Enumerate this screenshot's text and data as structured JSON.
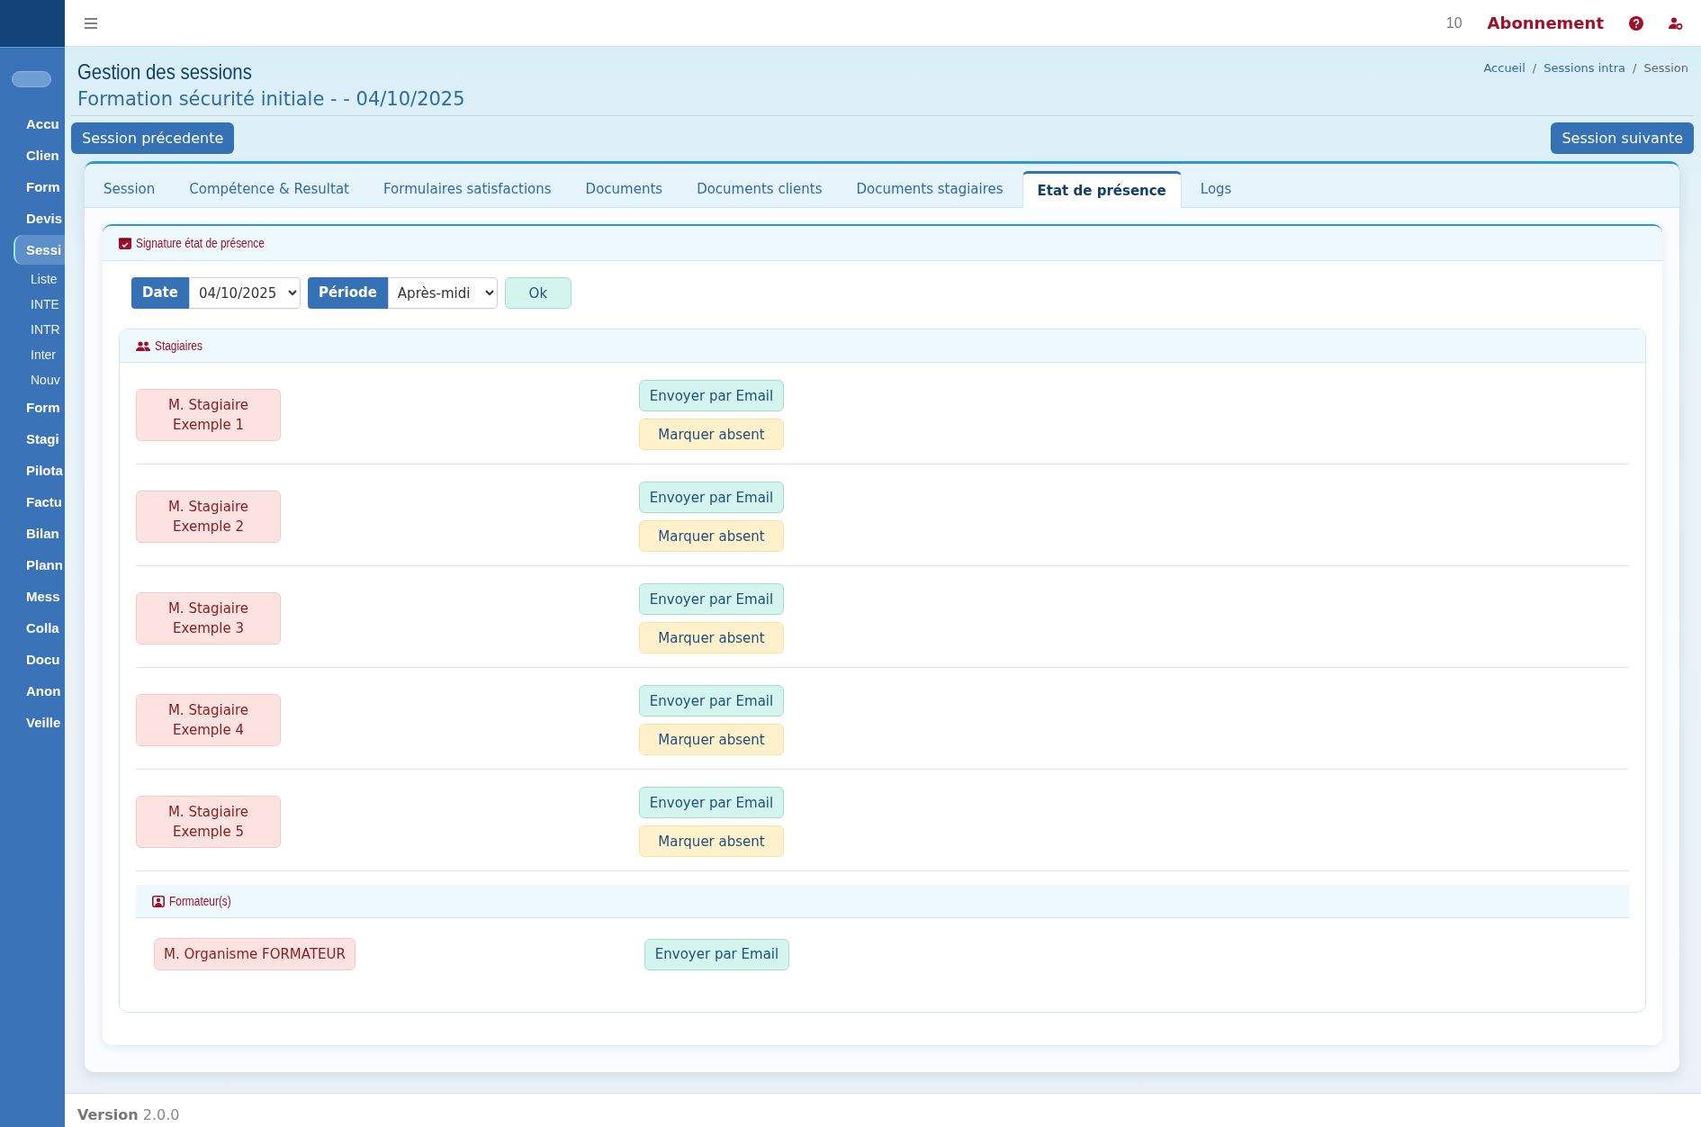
{
  "sidebar": {
    "toggle": {
      "on": false
    },
    "items": [
      {
        "label": "Accu",
        "selected": false
      },
      {
        "label": "Clien",
        "selected": false
      },
      {
        "label": "Form",
        "selected": false
      },
      {
        "label": "Devis",
        "selected": false
      },
      {
        "label": "Sessi",
        "selected": true,
        "children": [
          {
            "label": "Liste"
          },
          {
            "label": "INTE"
          },
          {
            "label": "INTR"
          },
          {
            "label": "Inter"
          },
          {
            "label": "Nouv"
          }
        ]
      },
      {
        "label": "Form",
        "selected": false
      },
      {
        "label": "Stagi",
        "selected": false
      },
      {
        "label": "Pilota",
        "selected": false
      },
      {
        "label": "Factu",
        "selected": false
      },
      {
        "label": "Bilan",
        "selected": false
      },
      {
        "label": "Plann",
        "selected": false
      },
      {
        "label": "Mess",
        "selected": false
      },
      {
        "label": "Colla",
        "selected": false
      },
      {
        "label": "Docu",
        "selected": false
      },
      {
        "label": "Anon",
        "selected": false
      },
      {
        "label": "Veille",
        "selected": false
      }
    ]
  },
  "topbar": {
    "counter": "10",
    "subscription": "Abonnement"
  },
  "page": {
    "title": "Gestion des sessions",
    "subtitle": "Formation sécurité initiale - - 04/10/2025",
    "breadcrumb": [
      {
        "label": "Accueil",
        "kind": "link"
      },
      {
        "label": "Sessions intra",
        "kind": "link"
      },
      {
        "label": "Session",
        "kind": "current"
      }
    ],
    "separator": "/"
  },
  "nav_buttons": {
    "previous": "Session précedente",
    "next": "Session suivante"
  },
  "tabs": [
    {
      "label": "Session",
      "selected": false
    },
    {
      "label": "Compétence & Resultat",
      "selected": false
    },
    {
      "label": "Formulaires satisfactions",
      "selected": false
    },
    {
      "label": "Documents",
      "selected": false
    },
    {
      "label": "Documents clients",
      "selected": false
    },
    {
      "label": "Documents stagiaires",
      "selected": false
    },
    {
      "label": "Etat de présence",
      "selected": true
    },
    {
      "label": "Logs",
      "selected": false
    }
  ],
  "attendance": {
    "title": "Signature état de présence",
    "filters": {
      "date_label": "Date",
      "date_value": "04/10/2025",
      "period_label": "Période",
      "period_value": "Après-midi",
      "submit": "Ok"
    },
    "trainees": {
      "title": "Stagiaires",
      "rows": [
        {
          "name": "M. Stagiaire Exemple 1",
          "actions": [
            {
              "label": "Envoyer par Email",
              "kind": "email"
            },
            {
              "label": "Marquer absent",
              "kind": "absent"
            }
          ]
        },
        {
          "name": "M. Stagiaire Exemple 2",
          "actions": [
            {
              "label": "Envoyer par Email",
              "kind": "email"
            },
            {
              "label": "Marquer absent",
              "kind": "absent"
            }
          ]
        },
        {
          "name": "M. Stagiaire Exemple 3",
          "actions": [
            {
              "label": "Envoyer par Email",
              "kind": "email"
            },
            {
              "label": "Marquer absent",
              "kind": "absent"
            }
          ]
        },
        {
          "name": "M. Stagiaire Exemple 4",
          "actions": [
            {
              "label": "Envoyer par Email",
              "kind": "email"
            },
            {
              "label": "Marquer absent",
              "kind": "absent"
            }
          ]
        },
        {
          "name": "M. Stagiaire Exemple 5",
          "actions": [
            {
              "label": "Envoyer par Email",
              "kind": "email"
            },
            {
              "label": "Marquer absent",
              "kind": "absent"
            }
          ]
        }
      ]
    },
    "trainers": {
      "title": "Formateur(s)",
      "rows": [
        {
          "name": "M. Organisme FORMATEUR",
          "actions": [
            {
              "label": "Envoyer par Email",
              "kind": "email"
            }
          ]
        }
      ]
    }
  },
  "footer": {
    "version_label": "Version",
    "version": "2.0.0"
  }
}
